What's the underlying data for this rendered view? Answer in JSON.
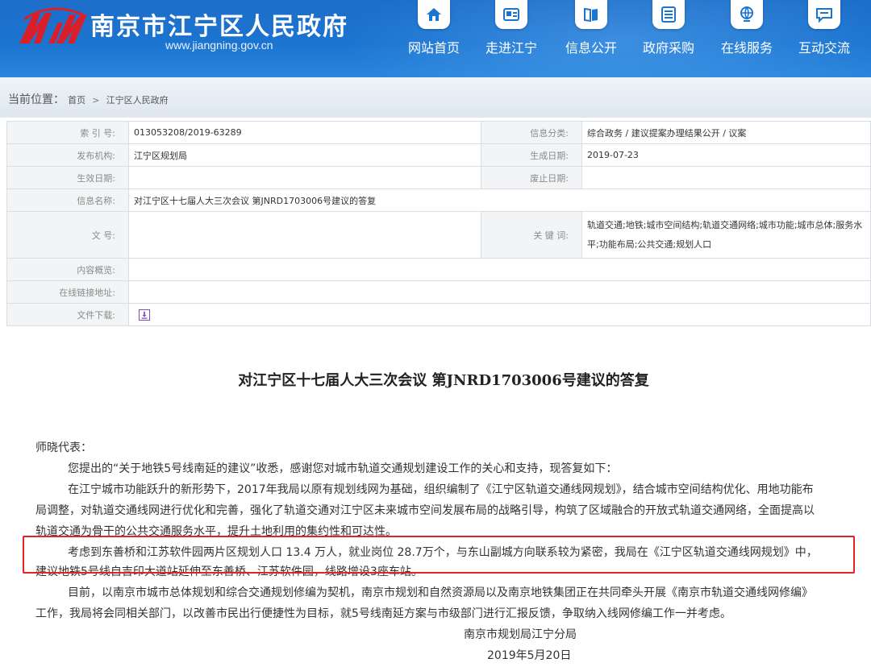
{
  "header": {
    "site_title": "南京市江宁区人民政府",
    "site_url": "www.jiangning.gov.cn",
    "nav": [
      {
        "label": "网站首页",
        "icon": "home-icon"
      },
      {
        "label": "走进江宁",
        "icon": "info-card-icon"
      },
      {
        "label": "信息公开",
        "icon": "book-icon"
      },
      {
        "label": "政府采购",
        "icon": "list-icon"
      },
      {
        "label": "在线服务",
        "icon": "globe-person-icon"
      },
      {
        "label": "互动交流",
        "icon": "chat-icon"
      }
    ]
  },
  "breadcrumb": {
    "lead": "当前位置：",
    "items": [
      "首页",
      "江宁区人民政府"
    ],
    "separator": ">"
  },
  "info": {
    "index_label": "索 引 号:",
    "index_value": "013053208/2019-63289",
    "category_label": "信息分类:",
    "category_value": "综合政务 / 建议提案办理结果公开 / 议案",
    "publisher_label": "发布机构:",
    "publisher_value": "江宁区规划局",
    "gen_date_label": "生成日期:",
    "gen_date_value": "2019-07-23",
    "effective_label": "生效日期:",
    "effective_value": "",
    "expire_label": "废止日期:",
    "expire_value": "",
    "name_label": "信息名称:",
    "name_value": "对江宁区十七届人大三次会议 第JNRD1703006号建议的答复",
    "docno_label": "文 号:",
    "docno_value": "",
    "keywords_label": "关 键 词:",
    "keywords_line1": "轨道交通;地铁;城市空间结构;轨道交通网络;城市功能;城市总体;服务水",
    "keywords_line2": "平;功能布局;公共交通;规划人口",
    "summary_label": "内容概览:",
    "summary_value": "",
    "link_label": "在线链接地址:",
    "link_value": "",
    "download_label": "文件下载:"
  },
  "doc": {
    "title": "对江宁区十七届人大三次会议 第JNRD1703006号建议的答复",
    "salutation": "师晓代表：",
    "p1": "您提出的“关于地铁5号线南延的建议”收悉，感谢您对城市轨道交通规划建设工作的关心和支持，现答复如下：",
    "p2_l1": "在江宁城市功能跃升的新形势下，2017年我局以原有规划线网为基础，组织编制了《江宁区轨道交通线网规划》，结合城市空间结构优化、用地功能布",
    "p2_l2": "局调整，对轨道交通线网进行优化和完善，强化了轨道交通对江宁区未来城市空间发展布局的战略引导，构筑了区域融合的开放式轨道交通网络，全面提高以",
    "p2_l3": "轨道交通为骨干的公共交通服务水平，提升土地利用的集约性和可达性。",
    "p3_l1": "考虑到东善桥和江苏软件园两片区规划人口 13.4 万人，就业岗位 28.7万个，与东山副城方向联系较为紧密，我局在《江宁区轨道交通线网规划》中，",
    "p3_l2": "建议地铁5号线自吉印大道站延伸至东善桥、江苏软件园，线路增设3座车站。",
    "p4_l1": "目前，以南京市城市总体规划和综合交通规划修编为契机，南京市规划和自然资源局以及南京地铁集团正在共同牵头开展《南京市轨道交通线网修编》",
    "p4_l2": "工作，我局将会同相关部门，以改善市民出行便捷性为目标，就5号线南延方案与市级部门进行汇报反馈，争取纳入线网修编工作一并考虑。",
    "signature": "南京市规划局江宁分局",
    "date": "2019年5月20日"
  },
  "colors": {
    "header_blue": "#1b74d0",
    "highlight_red": "#e02424"
  }
}
